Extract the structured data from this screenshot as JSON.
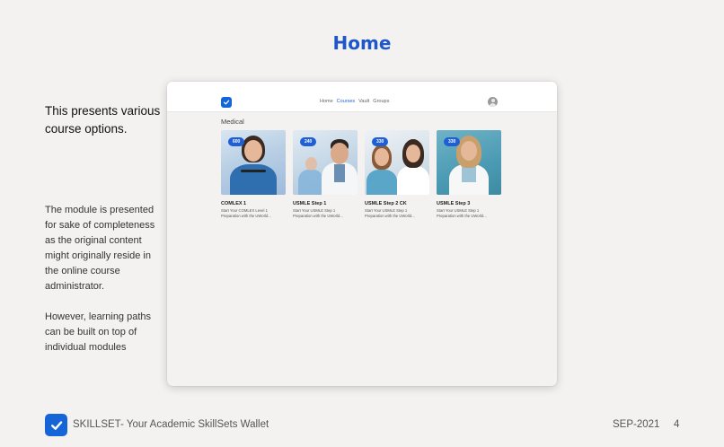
{
  "slide": {
    "title": "Home",
    "description_main": "This presents various course options.",
    "description_body": [
      "The module is presented for sake of completeness as the original content might originally reside in the online course administrator.",
      "However, learning paths can be built on top of individual modules"
    ]
  },
  "mockup": {
    "nav": {
      "links": [
        "Home",
        "Courses",
        "Vault",
        "Groups"
      ],
      "active": "Courses",
      "logo_icon": "check-icon",
      "avatar_icon": "user-avatar-icon"
    },
    "section_title": "Medical",
    "courses": [
      {
        "badge": "600",
        "title": "COMLEX 1",
        "desc_line1": "Start Your COMLEX Level 1",
        "desc_line2": "Preparation with the UWorld..."
      },
      {
        "badge": "240",
        "title": "USMLE Step 1",
        "desc_line1": "Start Your USMLE Step 1",
        "desc_line2": "Preparation with the UWorld..."
      },
      {
        "badge": "330",
        "title": "USMLE Step 2 CK",
        "desc_line1": "Start Your USMLE Step 1",
        "desc_line2": "Preparation with the UWorld..."
      },
      {
        "badge": "330",
        "title": "USMLE Step 3",
        "desc_line1": "Start Your USMLE Step 1",
        "desc_line2": "Preparation with the UWorld..."
      }
    ]
  },
  "footer": {
    "brand_text": "SKILLSET- Your Academic SkillSets Wallet",
    "date": "SEP-2021",
    "page_number": "4",
    "logo_icon": "check-icon"
  },
  "colors": {
    "accent": "#1f57c9",
    "brand_blue": "#1565d8",
    "background": "#f3f2f0"
  }
}
